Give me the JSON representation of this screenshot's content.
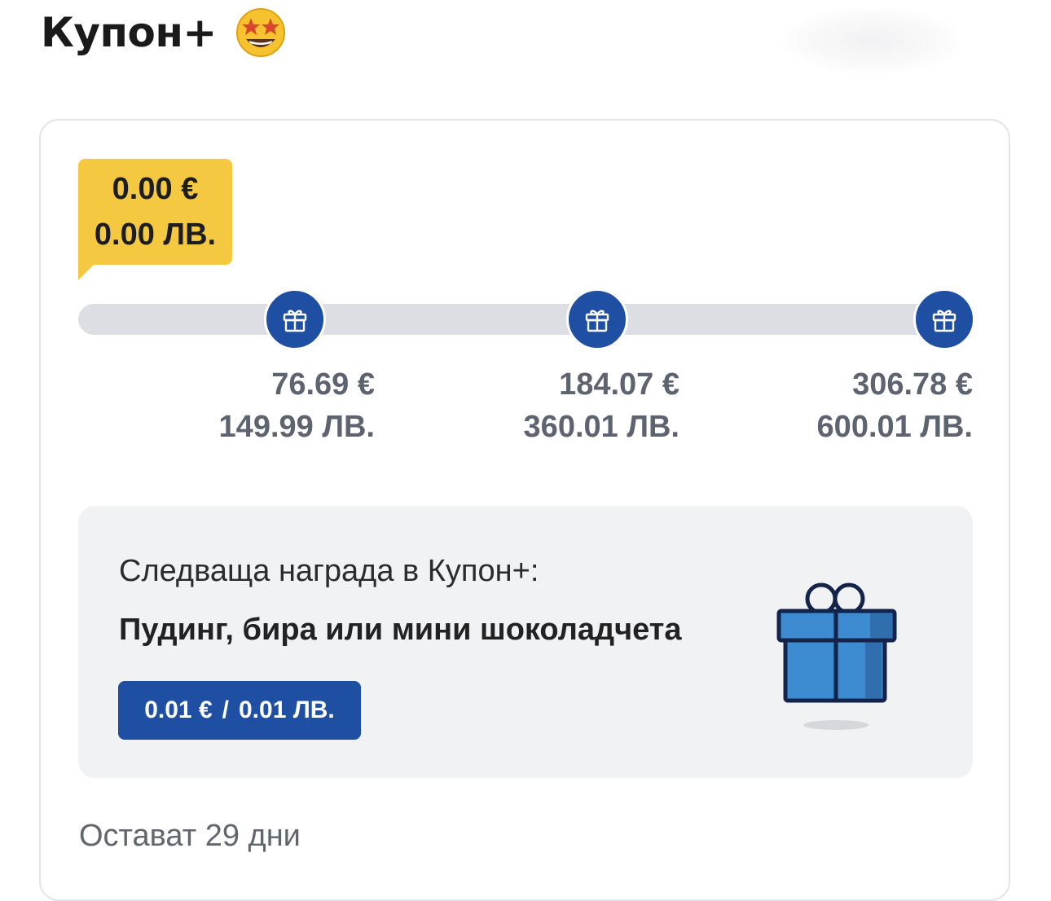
{
  "header": {
    "title": "Купон+",
    "title_emoji_icon": "star-struck-emoji-icon"
  },
  "progress": {
    "current_eur": "0.00 €",
    "current_bgn": "0.00 ЛВ.",
    "progress_fraction": 0.0,
    "milestones": [
      {
        "eur": "76.69 €",
        "bgn": "149.99 ЛВ.",
        "icon": "gift-icon"
      },
      {
        "eur": "184.07 €",
        "bgn": "360.01 ЛВ.",
        "icon": "gift-icon"
      },
      {
        "eur": "306.78 €",
        "bgn": "600.01 ЛВ.",
        "icon": "gift-icon"
      }
    ]
  },
  "reward": {
    "intro": "Следваща награда в Купон+:",
    "name": "Пудинг, бира или мини шоколадчета",
    "price_eur": "0.01 €",
    "separator": "/",
    "price_bgn": "0.01 ЛВ.",
    "illustration_icon": "gift-box-icon"
  },
  "footer": {
    "days_left": "Остават 29 дни"
  },
  "colors": {
    "accent_blue": "#1f4fa3",
    "badge_yellow": "#f5c842",
    "track_gray": "#dcdee3",
    "panel_gray": "#f1f2f4",
    "muted_text": "#5d6470"
  }
}
